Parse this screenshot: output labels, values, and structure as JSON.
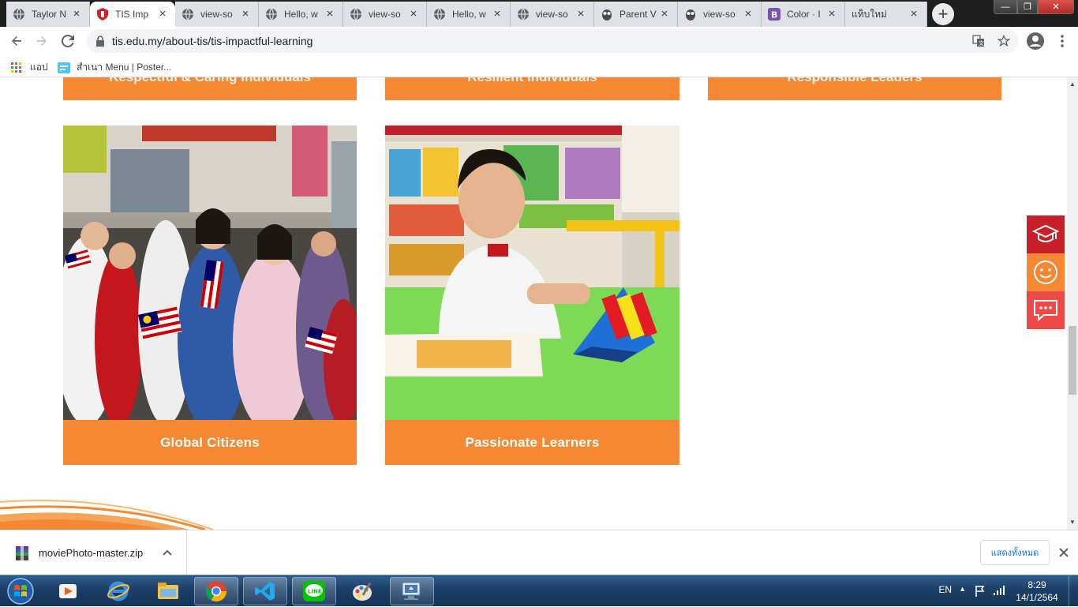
{
  "browser": {
    "tabs": [
      {
        "title": "Taylor N",
        "icon": "globe-icon",
        "active": false
      },
      {
        "title": "TIS Imp",
        "icon": "shield-icon",
        "active": true
      },
      {
        "title": "view-so",
        "icon": "globe-icon",
        "active": false
      },
      {
        "title": "Hello, w",
        "icon": "globe-icon",
        "active": false
      },
      {
        "title": "view-so",
        "icon": "globe-icon",
        "active": false
      },
      {
        "title": "Hello, w",
        "icon": "globe-icon",
        "active": false
      },
      {
        "title": "view-so",
        "icon": "globe-icon",
        "active": false
      },
      {
        "title": "Parent V",
        "icon": "owl-icon",
        "active": false
      },
      {
        "title": "view-so",
        "icon": "owl-icon",
        "active": false
      },
      {
        "title": "Color · I",
        "icon": "bootstrap-icon",
        "active": false
      },
      {
        "title": "แท็บใหม่",
        "icon": "none",
        "active": false
      }
    ],
    "url": "tis.edu.my/about-tis/tis-impactful-learning",
    "bookmarks": [
      {
        "label": "แอป",
        "icon": "apps-grid-icon"
      },
      {
        "label": "สำเนา Menu | Poster...",
        "icon": "bookmark-page-icon"
      }
    ]
  },
  "page": {
    "top_row_labels": [
      "Respectful & Caring Individuals",
      "Resilient Individuals",
      "Responsible Leaders"
    ],
    "cards": [
      {
        "caption": "Global Citizens",
        "photo": "students-with-malaysian-flags-photo"
      },
      {
        "caption": "Passionate Learners",
        "photo": "boy-with-flip-chart-photo"
      }
    ],
    "side_widget": [
      {
        "icon": "graduation-cap-icon",
        "color": "#c8202a"
      },
      {
        "icon": "smiley-icon",
        "color": "#f68833"
      },
      {
        "icon": "chat-icon",
        "color": "#ef4a4a"
      }
    ],
    "accent_color": "#f68833"
  },
  "downloads": {
    "file_name": "moviePhoto-master.zip",
    "show_all_label": "แสดงทั้งหมด"
  },
  "taskbar": {
    "apps": [
      "start-orb-icon",
      "media-player-icon",
      "internet-explorer-icon",
      "file-explorer-icon",
      "chrome-icon",
      "vscode-icon",
      "line-icon",
      "paint-icon",
      "network-tool-icon"
    ],
    "language": "EN",
    "time": "8:29",
    "date": "14/1/2564"
  }
}
